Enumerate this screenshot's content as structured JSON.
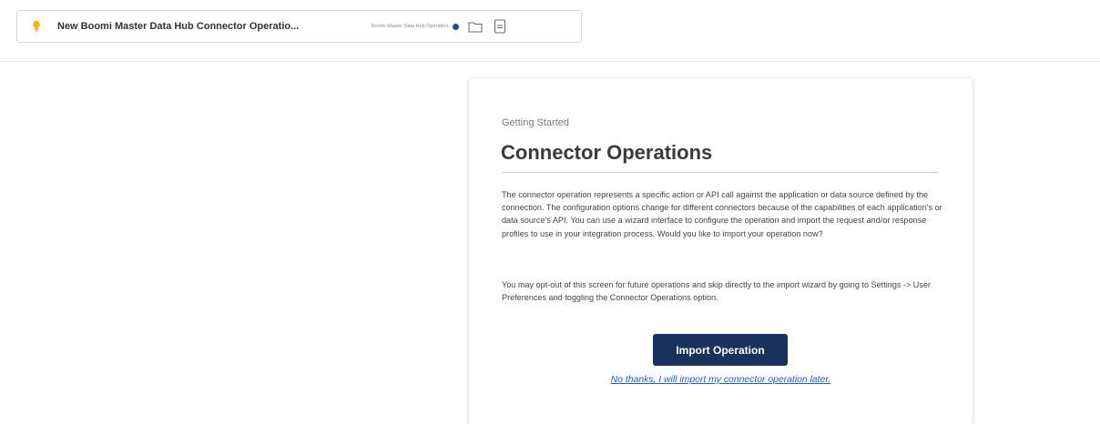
{
  "tab": {
    "title": "New Boomi Master Data Hub Connector Operatio...",
    "type_label": "Boomi Master Data Hub Operation",
    "bulb_icon": "lightbulb-icon",
    "folder_icon": "folder-icon",
    "doc_icon": "document-icon",
    "accent": "#1f4e97"
  },
  "card": {
    "eyebrow": "Getting Started",
    "title": "Connector Operations",
    "paragraph1": "The connector operation represents a specific action or API call against the application or data source defined by the connection. The configuration options change for different connectors because of the capabilities of each application's or data source's API. You can use a wizard interface to configure the operation and import the request and/or response profiles to use in your integration process. Would you like to import your operation now?",
    "paragraph2": "You may opt-out of this screen for future operations and skip directly to the import wizard by going to Settings -> User Preferences and toggling the Connector Operations option.",
    "import_button": "Import Operation",
    "later_link": "No thanks, I will import my connector operation later.",
    "button_color": "#17325c",
    "link_color": "#1f5fbf"
  }
}
